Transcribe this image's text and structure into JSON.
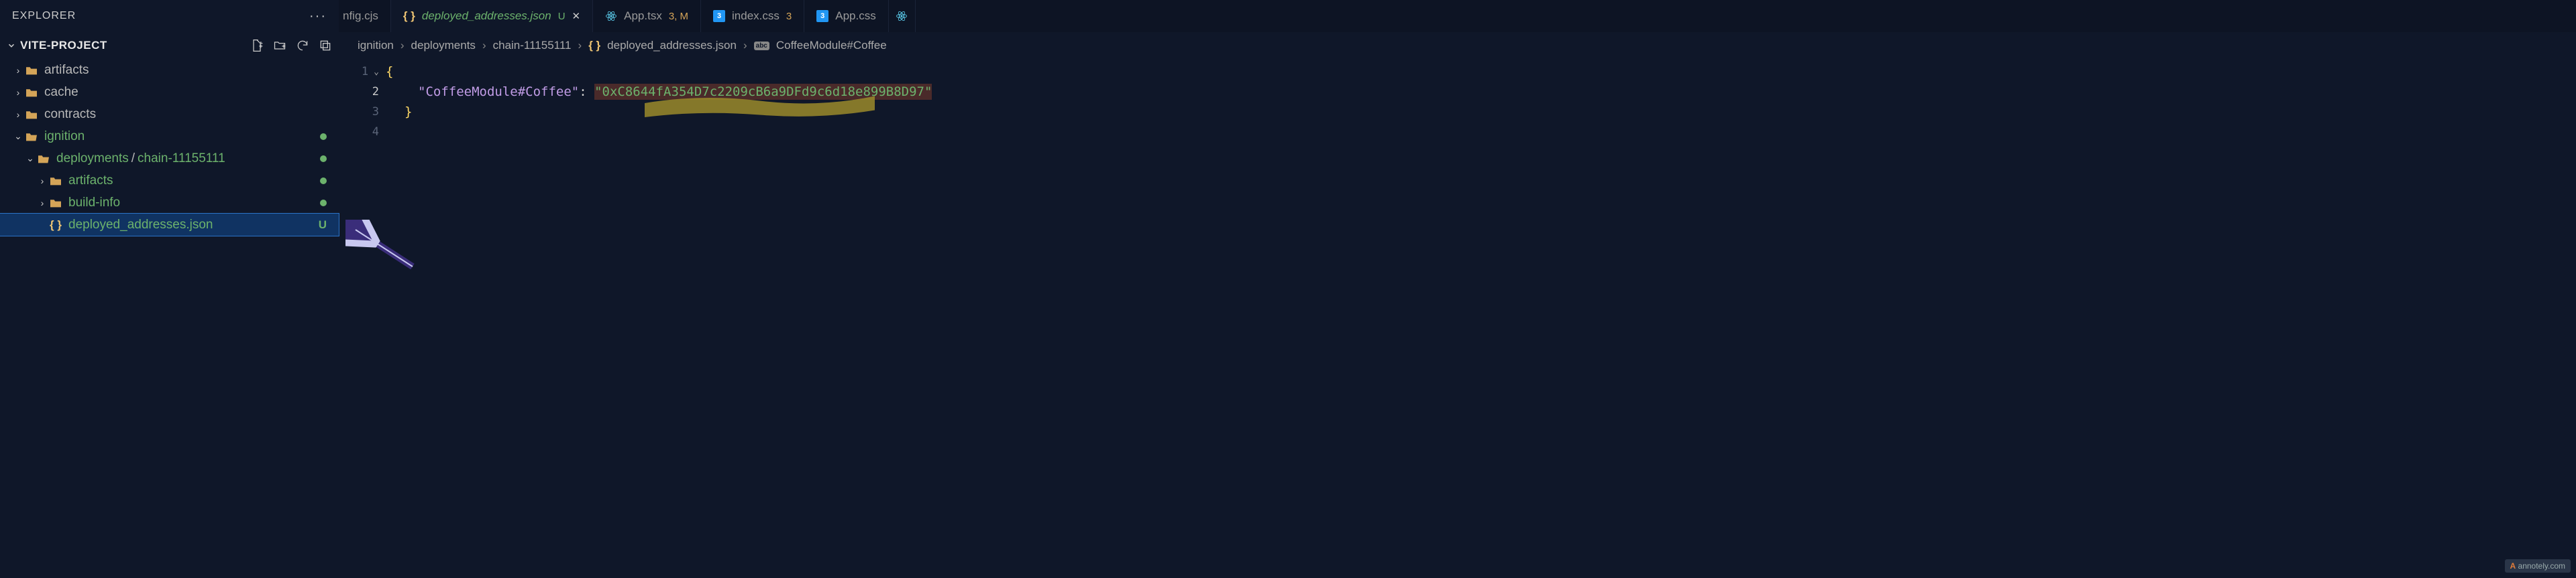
{
  "explorer": {
    "title": "EXPLORER"
  },
  "project": {
    "name": "VITE-PROJECT"
  },
  "tree": [
    {
      "type": "folder",
      "label": "artifacts",
      "expanded": false,
      "indent": 0,
      "git": null
    },
    {
      "type": "folder",
      "label": "cache",
      "expanded": false,
      "indent": 0,
      "git": null
    },
    {
      "type": "folder",
      "label": "contracts",
      "expanded": false,
      "indent": 0,
      "git": null
    },
    {
      "type": "folder",
      "label": "ignition",
      "expanded": true,
      "indent": 0,
      "git": "dot",
      "color": "green"
    },
    {
      "type": "folder-combo",
      "label1": "deployments",
      "label2": "chain-11155111",
      "expanded": true,
      "indent": 1,
      "git": "dot",
      "color": "green"
    },
    {
      "type": "folder",
      "label": "artifacts",
      "expanded": false,
      "indent": 2,
      "git": "dot",
      "color": "green"
    },
    {
      "type": "folder",
      "label": "build-info",
      "expanded": false,
      "indent": 2,
      "git": "dot",
      "color": "green"
    },
    {
      "type": "file-json",
      "label": "deployed_addresses.json",
      "indent": 2,
      "git": "U",
      "color": "green",
      "selected": true
    }
  ],
  "tabs": [
    {
      "icon": null,
      "label": "nfig.cjs",
      "partial": true
    },
    {
      "icon": "json",
      "label": "deployed_addresses.json",
      "badge": "U",
      "italic": true,
      "active": true,
      "close": true,
      "color": "green"
    },
    {
      "icon": "react",
      "label": "App.tsx",
      "badge": "3, M",
      "badgecolor": "orange"
    },
    {
      "icon": "css3",
      "label": "index.css",
      "badge": "3",
      "badgecolor": "orange"
    },
    {
      "icon": "css3",
      "label": "App.css"
    }
  ],
  "breadcrumbs": [
    {
      "type": "text",
      "label": "ignition"
    },
    {
      "type": "text",
      "label": "deployments"
    },
    {
      "type": "text",
      "label": "chain-11155111"
    },
    {
      "type": "json",
      "label": "deployed_addresses.json"
    },
    {
      "type": "abc",
      "label": "CoffeeModule#Coffee"
    }
  ],
  "code": {
    "lines": [
      "1",
      "2",
      "3",
      "4"
    ],
    "key": "\"CoffeeModule#Coffee\"",
    "value": "\"0xC8644fA354D7c2209cB6a9DFd9c6d18e899B8D97\""
  },
  "watermark": "annotely.com"
}
